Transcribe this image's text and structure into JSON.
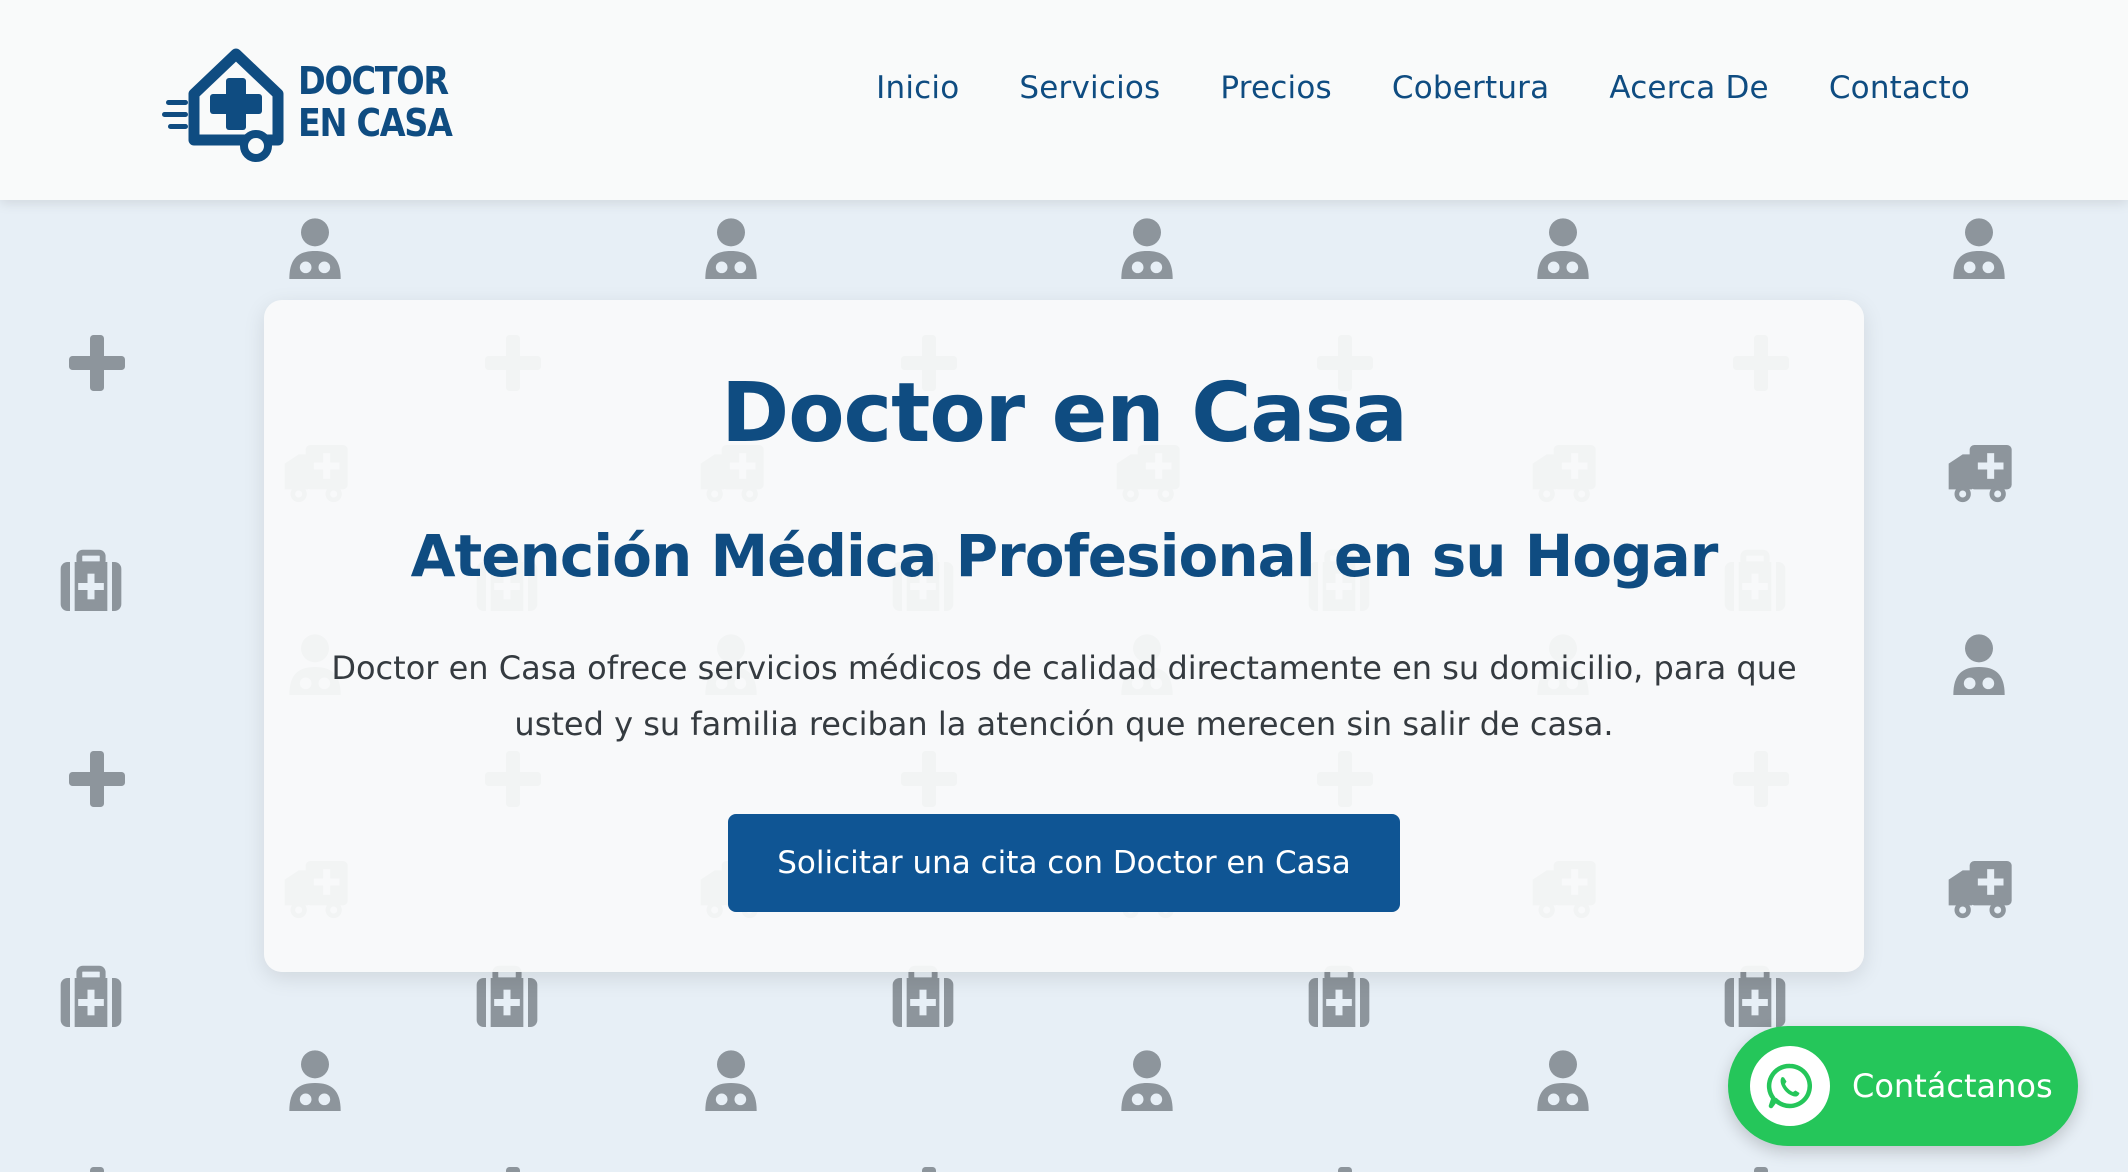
{
  "logo": {
    "line1": "DOCTOR",
    "line2": "EN CASA",
    "icon": "house-medical-cross-icon"
  },
  "nav": {
    "items": [
      {
        "label": "Inicio"
      },
      {
        "label": "Servicios"
      },
      {
        "label": "Precios"
      },
      {
        "label": "Cobertura"
      },
      {
        "label": "Acerca De"
      },
      {
        "label": "Contacto"
      }
    ]
  },
  "hero": {
    "title": "Doctor en Casa",
    "subtitle": "Atención Médica Profesional en su Hogar",
    "description": "Doctor en Casa ofrece servicios médicos de calidad directamente en su domicilio, para que usted y su familia reciban la atención que merecen sin salir de casa.",
    "cta_label": "Solicitar una cita con Doctor en Casa"
  },
  "whatsapp": {
    "label": "Contáctanos",
    "icon": "whatsapp-icon"
  },
  "background": {
    "pattern_icons": [
      "doctor-icon",
      "plus-icon",
      "ambulance-icon",
      "medical-kit-icon"
    ]
  },
  "colors": {
    "brand": "#0f4c81",
    "button": "#0f5594",
    "whatsapp": "#25c65a",
    "background": "#e7eff6",
    "pattern_icon": "#8d959c"
  }
}
